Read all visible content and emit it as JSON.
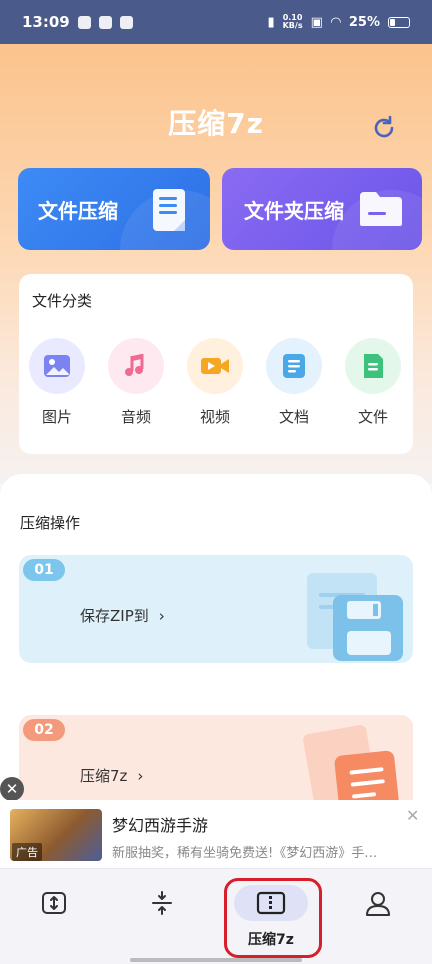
{
  "status_bar": {
    "time": "13:09",
    "net_speed_top": "0.10",
    "net_speed_unit": "KB/s",
    "battery": "25%"
  },
  "header": {
    "title": "压缩7z",
    "refresh_icon": "refresh-icon"
  },
  "actions": {
    "file_compress": "文件压缩",
    "folder_compress": "文件夹压缩"
  },
  "categories": {
    "title": "文件分类",
    "items": [
      {
        "label": "图片",
        "icon": "image-icon",
        "bg": "#e9eaff",
        "color": "#7b83f0"
      },
      {
        "label": "音频",
        "icon": "music-icon",
        "bg": "#fde9ef",
        "color": "#f06b94"
      },
      {
        "label": "视频",
        "icon": "video-icon",
        "bg": "#fff1dd",
        "color": "#f5a623"
      },
      {
        "label": "文档",
        "icon": "document-icon",
        "bg": "#e3f2fc",
        "color": "#4aa7e8"
      },
      {
        "label": "文件",
        "icon": "file-icon",
        "bg": "#e3f7ea",
        "color": "#3cc27a"
      }
    ]
  },
  "operations": {
    "title": "压缩操作",
    "items": [
      {
        "badge": "01",
        "label": "保存ZIP到"
      },
      {
        "badge": "02",
        "label": "压缩7z"
      }
    ]
  },
  "ad": {
    "title": "梦幻西游手游",
    "description": "新服抽奖，稀有坐骑免费送!《梦幻西游》手…",
    "tag": "广告"
  },
  "bottom_nav": {
    "items": [
      {
        "label": "",
        "icon": "resize-icon"
      },
      {
        "label": "",
        "icon": "compress-icon"
      },
      {
        "label": "压缩7z",
        "icon": "archive-icon",
        "active": true
      },
      {
        "label": "",
        "icon": "user-icon"
      }
    ]
  },
  "colors": {
    "accent_blue": "#2e6fe6",
    "accent_purple": "#6b55e8",
    "highlight_red": "#d61f2a"
  }
}
